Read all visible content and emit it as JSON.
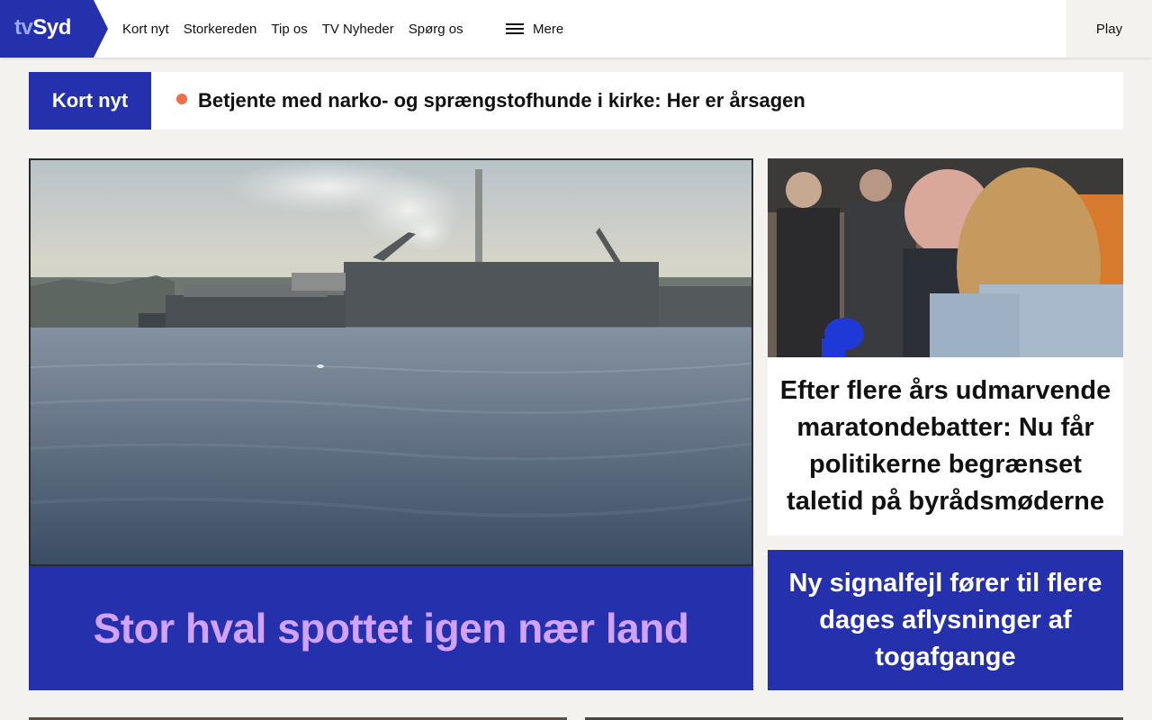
{
  "brand": {
    "logo_prefix": "tv",
    "logo_suffix": "Syd",
    "primary_color": "#2530ad",
    "accent_color": "#d3a2ff",
    "ticker_dot_color": "#ef6f4c"
  },
  "nav": {
    "items": [
      {
        "label": "Kort nyt"
      },
      {
        "label": "Storkereden"
      },
      {
        "label": "Tip os"
      },
      {
        "label": "TV Nyheder"
      },
      {
        "label": "Spørg os"
      }
    ],
    "more_label": "Mere",
    "more_icon": "hamburger-menu-icon",
    "play_label": "Play"
  },
  "ticker": {
    "label": "Kort nyt",
    "headline": "Betjente med narko- og sprængstofhunde i kirke: Her er årsagen"
  },
  "main_article": {
    "title": "Stor hval spottet igen nær land",
    "image": "whale-harbour-photo"
  },
  "side_articles": [
    {
      "title": "Efter flere års udmarvende maratondebatter: Nu får politikerne begrænset taletid på byrådsmøderne",
      "image": "politician-hug-photo"
    },
    {
      "title": "Ny signalfejl fører til flere dages aflysninger af togafgange"
    }
  ]
}
